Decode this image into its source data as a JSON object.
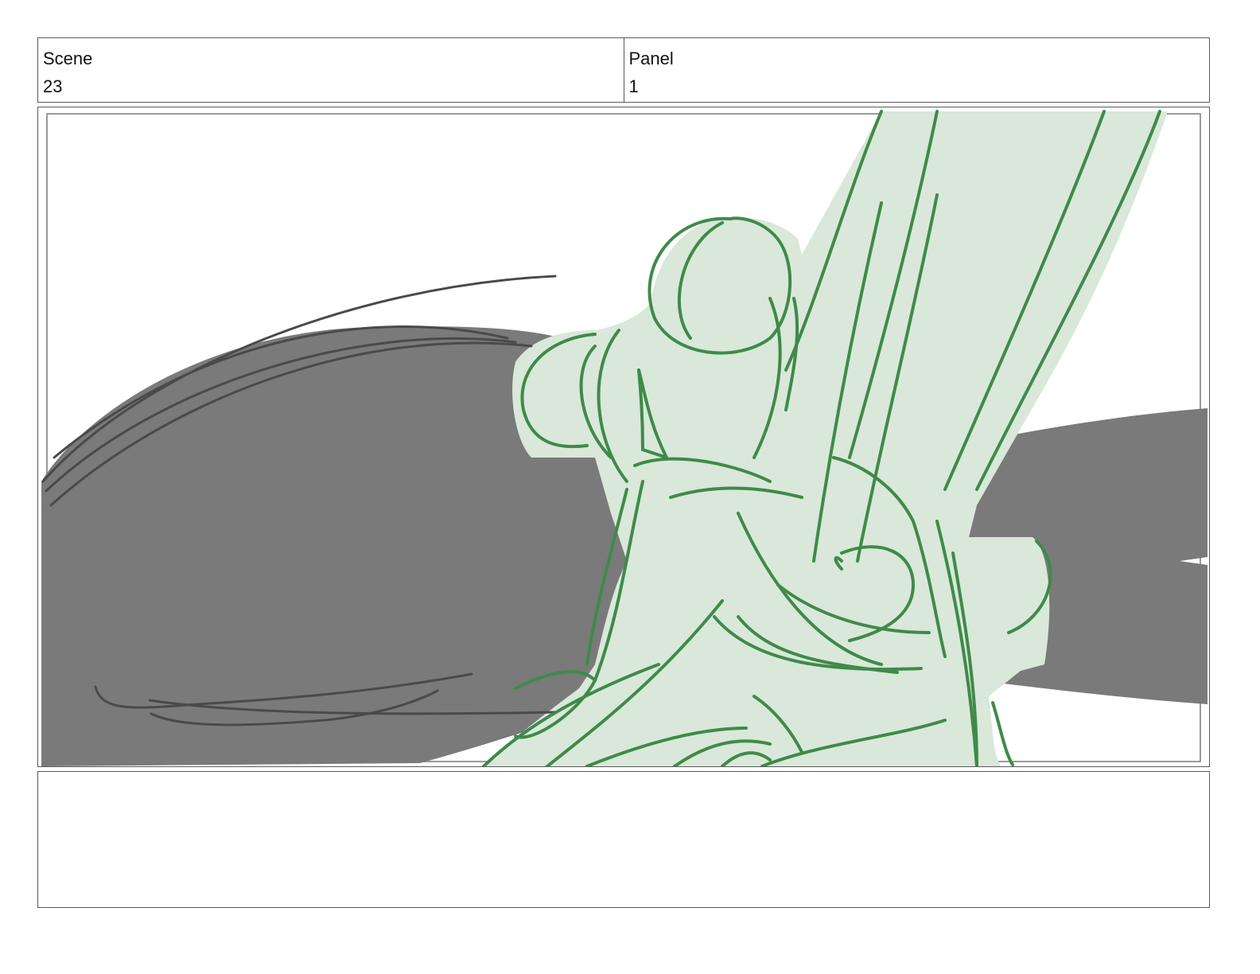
{
  "header": {
    "scene_label": "Scene",
    "scene_value": "23",
    "panel_label": "Panel",
    "panel_value": "1"
  },
  "notes": {
    "text": ""
  },
  "colors": {
    "border": "#5a5a5a",
    "shadow_gray": "#7a7a7a",
    "figure_fill": "#d9e8d9",
    "figure_line": "#3f8a4a",
    "sketch_line": "#4a4a4a"
  }
}
